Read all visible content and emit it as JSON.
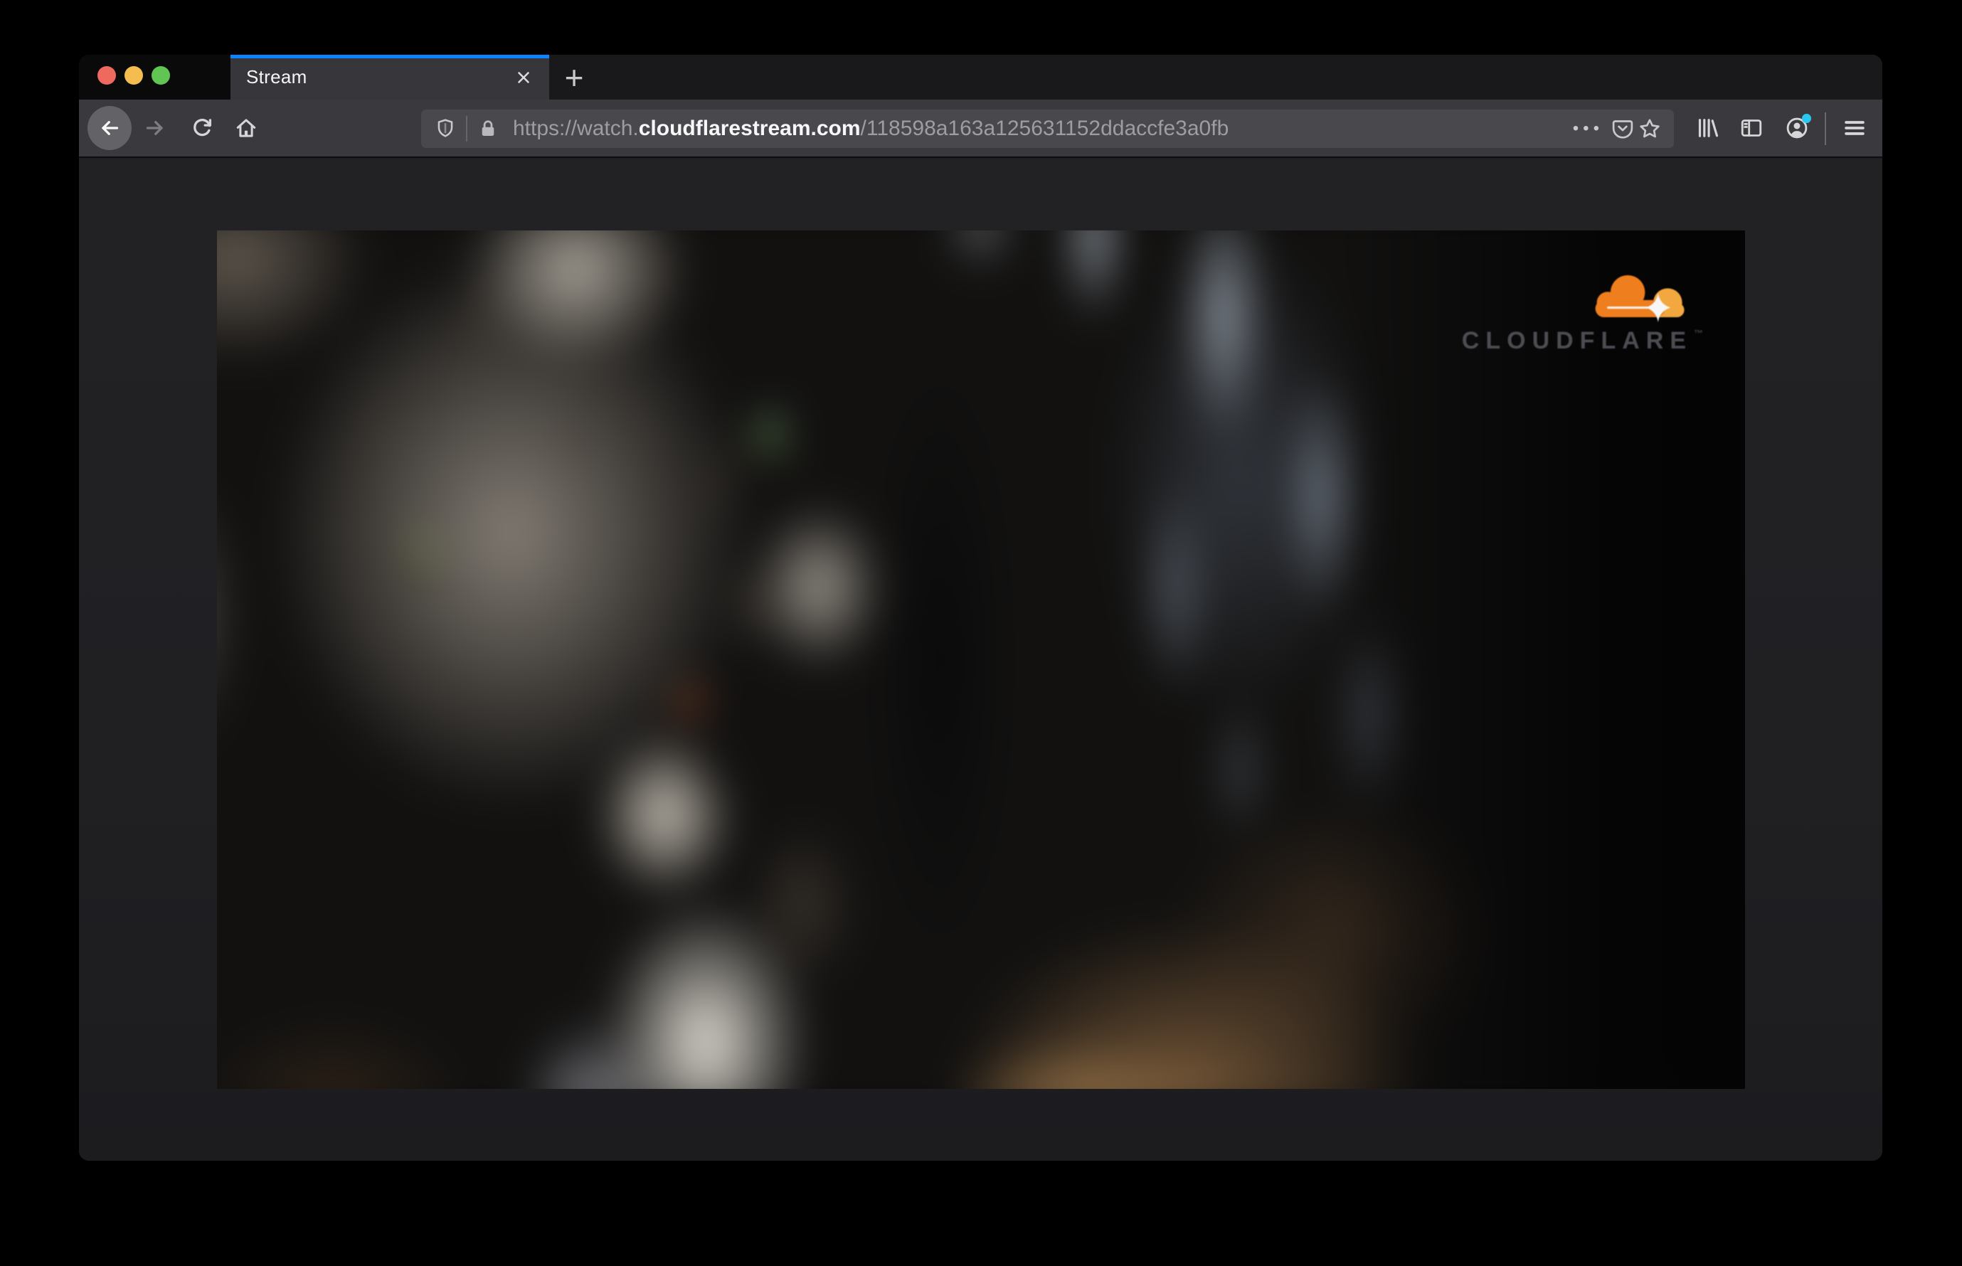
{
  "window": {
    "traffic_lights": [
      {
        "name": "close"
      },
      {
        "name": "minimize"
      },
      {
        "name": "zoom"
      }
    ]
  },
  "tab_bar": {
    "active_tab": {
      "title": "Stream"
    },
    "new_tab_glyph": "+"
  },
  "toolbar": {
    "icons": [
      "back-arrow",
      "forward-arrow",
      "reload",
      "home",
      "shield",
      "lock",
      "page-actions-ellipsis",
      "pocket",
      "bookmark-star",
      "library",
      "sidebar",
      "account",
      "menu-hamburger"
    ],
    "url": {
      "prefix": "https://watch.",
      "domain": "cloudflarestream.com",
      "path": "/118598a163a125631152ddaccfe3a0fb"
    },
    "page_actions_glyph": "•••"
  },
  "video": {
    "description": "Blurred close-up video frame of a gray tabby cat with green eyes, blue-gray bokeh background and brown shoulder",
    "logo_text": "CLOUDFLARE",
    "logo_tm": "™"
  },
  "colors": {
    "accent_blue": "#0a84ff",
    "traffic_close": "#ee6a5f",
    "traffic_min": "#f5bd4f",
    "traffic_zoom": "#61c554",
    "toolbar_bg": "#3a3a3e",
    "urlbar_bg": "#48484d",
    "page_bg": "#202023",
    "notification_dot": "#29c8f1",
    "cloudflare_orange": "#f6821f",
    "cloudflare_orange_light": "#fbad41"
  }
}
